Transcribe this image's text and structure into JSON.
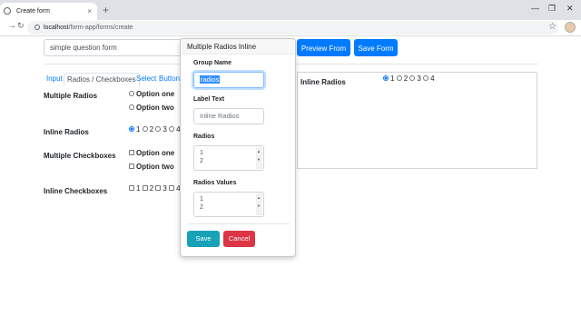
{
  "browser": {
    "tab_title": "Create form",
    "tab_close": "×",
    "new_tab": "+",
    "back": "←",
    "forward": "→",
    "reload": "C",
    "url_host": "localhost",
    "url_path": "/form-app/forms/create",
    "star": "☆",
    "minimize": "—",
    "restore": "❐",
    "close": "✕"
  },
  "page": {
    "form_name_value": "simple question form",
    "preview_button": "Preview From",
    "save_form_button": "Save Form",
    "tabs": [
      "Input",
      "Radios / Checkboxes",
      "Select",
      "Button"
    ],
    "fields": {
      "multiple_radios": {
        "label": "Multiple Radios",
        "options": [
          "Option one",
          "Option two"
        ]
      },
      "inline_radios": {
        "label": "Inline Radios",
        "options": [
          "1",
          "2",
          "3",
          "4"
        ]
      },
      "multiple_checkboxes": {
        "label": "Multiple Checkboxes",
        "options": [
          "Option one",
          "Option two"
        ]
      },
      "inline_checkboxes": {
        "label": "Inline Checkboxes",
        "options": [
          "1",
          "2",
          "3",
          "4"
        ]
      }
    },
    "preview": {
      "label": "Inline Radios",
      "options": [
        "1",
        "2",
        "3",
        "4"
      ]
    }
  },
  "popover": {
    "title": "Multiple Radios Inline",
    "group_name_label": "Group Name",
    "group_name_value": "radios",
    "label_text_label": "Label Text",
    "label_text_placeholder": "Inline Radios",
    "radios_label": "Radios",
    "radios_lines": [
      "1",
      "2"
    ],
    "radios_values_label": "Radios Values",
    "radios_values_lines": [
      "1",
      "2"
    ],
    "save_button": "Save",
    "cancel_button": "Cancel"
  },
  "colors": {
    "primary": "#007bff",
    "info": "#17a2b8",
    "danger": "#dc3545"
  }
}
